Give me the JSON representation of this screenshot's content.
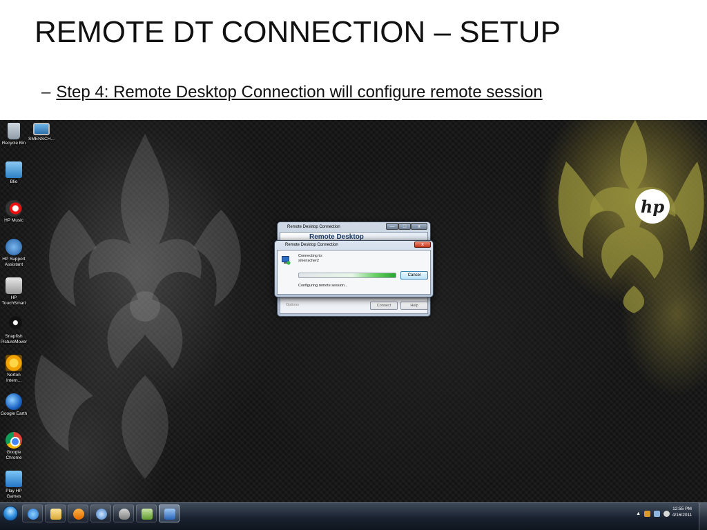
{
  "slide": {
    "title": "REMOTE DT CONNECTION – SETUP",
    "bullet_dash": "–",
    "bullet_text": "Step 4:  Remote Desktop Connection will configure remote session"
  },
  "desktop": {
    "brand_logo": "hp",
    "icons": [
      {
        "label": "Recycle Bin",
        "icon": "recycle-bin-icon"
      },
      {
        "label": "SMENSCH...",
        "icon": "computer-icon"
      },
      {
        "label": "Blio",
        "icon": "blio-icon"
      },
      {
        "label": "HP Music",
        "icon": "hp-music-icon"
      },
      {
        "label": "HP Support Assistant",
        "icon": "hp-support-icon"
      },
      {
        "label": "HP TouchSmart",
        "icon": "touchsmart-icon"
      },
      {
        "label": "Snapfish PictureMover",
        "icon": "snapfish-icon"
      },
      {
        "label": "Norton Intern...",
        "icon": "norton-icon"
      },
      {
        "label": "Google Earth",
        "icon": "google-earth-icon"
      },
      {
        "label": "Google Chrome",
        "icon": "chrome-icon"
      },
      {
        "label": "Play HP Games",
        "icon": "games-icon"
      }
    ]
  },
  "rdc_main": {
    "title": "Remote Desktop Connection",
    "banner": "Remote Desktop",
    "options_label": "Options",
    "connect_label": "Connect",
    "help_label": "Help",
    "minimize_glyph": "—",
    "maximize_glyph": "□",
    "close_glyph": "x"
  },
  "rdc_progress": {
    "title": "Remote Desktop Connection",
    "close_glyph": "x",
    "connecting_label": "Connecting to:",
    "host": "smenscher2",
    "status": "Configuring remote session...",
    "cancel_label": "Cancel",
    "progress_fraction": 1.0
  },
  "taskbar": {
    "apps": [
      "internet-explorer-icon",
      "explorer-icon",
      "media-player-icon",
      "hp-icon",
      "security-icon",
      "hp-app-icon",
      "remote-desktop-icon"
    ],
    "tray_arrow": "▲",
    "time": "12:55 PM",
    "date": "4/16/2011"
  },
  "colors": {
    "desktop_bg": "#141414",
    "damask_gold": "#8f8a3a",
    "taskbar": "#1a2230"
  }
}
